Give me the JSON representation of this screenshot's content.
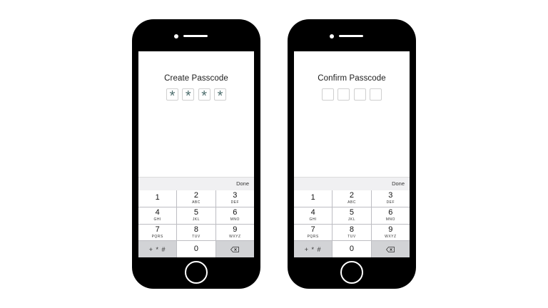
{
  "phones": [
    {
      "title": "Create Passcode",
      "code_boxes": [
        "*",
        "*",
        "*",
        "*"
      ],
      "done_label": "Done"
    },
    {
      "title": "Confirm Passcode",
      "code_boxes": [
        "",
        "",
        "",
        ""
      ],
      "done_label": "Done"
    }
  ],
  "keypad": {
    "keys": [
      {
        "digit": "1",
        "letters": ""
      },
      {
        "digit": "2",
        "letters": "ABC"
      },
      {
        "digit": "3",
        "letters": "DEF"
      },
      {
        "digit": "4",
        "letters": "GHI"
      },
      {
        "digit": "5",
        "letters": "JKL"
      },
      {
        "digit": "6",
        "letters": "MNO"
      },
      {
        "digit": "7",
        "letters": "PQRS"
      },
      {
        "digit": "8",
        "letters": "TUV"
      },
      {
        "digit": "9",
        "letters": "WXYZ"
      }
    ],
    "symbols_label": "+ * #",
    "zero_digit": "0",
    "backspace_icon": "backspace-icon"
  }
}
